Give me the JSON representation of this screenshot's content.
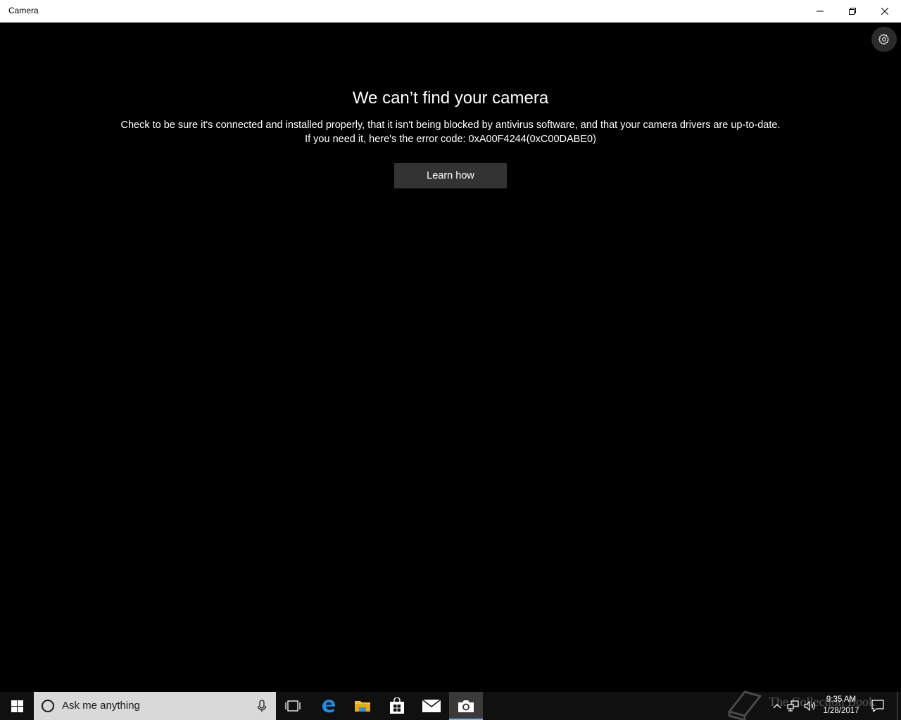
{
  "window": {
    "title": "Camera",
    "minimize_icon": "minimize-icon",
    "maximize_icon": "restore-icon",
    "close_icon": "close-icon"
  },
  "app": {
    "settings_icon": "gear-icon",
    "error_title": "We can’t find your camera",
    "error_message_line1": "Check to be sure it's connected and installed properly, that it isn't being blocked by antivirus software, and that your camera drivers are up-to-date.",
    "error_message_line2": "If you need it, here's the error code: 0xA00F4244(0xC00DABE0)",
    "learn_button": "Learn how"
  },
  "taskbar": {
    "search_placeholder": "Ask me anything",
    "pinned": [
      "task-view",
      "edge",
      "file-explorer",
      "store",
      "mail",
      "camera"
    ],
    "active_app": "camera",
    "clock_time": "9:35 AM",
    "clock_date": "1/28/2017",
    "watermark": "The Collection Book"
  },
  "colors": {
    "app_background": "#000000",
    "button_background": "#333333",
    "taskbar_background": "#101010",
    "search_background": "#d9d9d9",
    "accent": "#0078d7"
  }
}
